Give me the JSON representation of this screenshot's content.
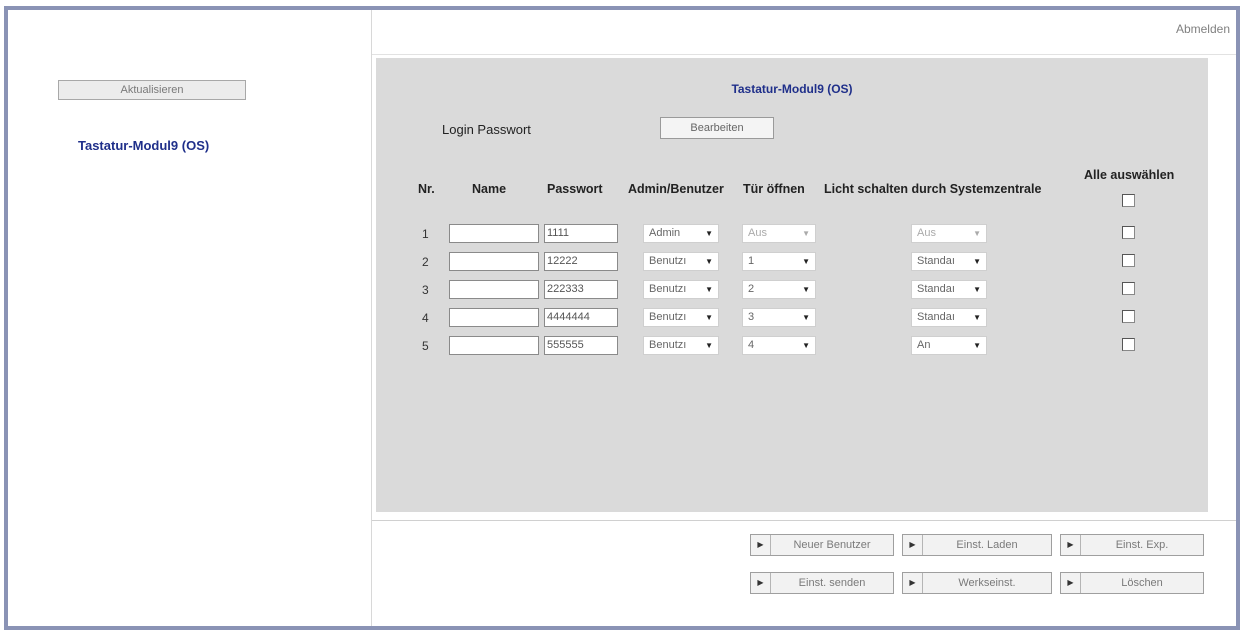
{
  "header": {
    "logout_label": "Abmelden"
  },
  "sidebar": {
    "refresh_label": "Aktualisieren",
    "module_link": "Tastatur-Modul9 (OS)"
  },
  "panel": {
    "title": "Tastatur-Modul9 (OS)",
    "login_label": "Login Passwort",
    "edit_label": "Bearbeiten",
    "columns": {
      "nr": "Nr.",
      "name": "Name",
      "password": "Passwort",
      "role": "Admin/Benutzer",
      "door": "Tür öffnen",
      "light": "Licht schalten durch Systemzentrale",
      "select_all": "Alle auswählen"
    },
    "rows": [
      {
        "nr": "1",
        "name": "",
        "password": "1111",
        "role": "Admin",
        "door": "Aus",
        "light": "Aus"
      },
      {
        "nr": "2",
        "name": "",
        "password": "12222",
        "role": "Benutzı",
        "door": "1",
        "light": "Standaı"
      },
      {
        "nr": "3",
        "name": "",
        "password": "222333",
        "role": "Benutzı",
        "door": "2",
        "light": "Standaı"
      },
      {
        "nr": "4",
        "name": "",
        "password": "4444444",
        "role": "Benutzı",
        "door": "3",
        "light": "Standaı"
      },
      {
        "nr": "5",
        "name": "",
        "password": "555555",
        "role": "Benutzı",
        "door": "4",
        "light": "An"
      }
    ]
  },
  "actions": {
    "new_user": "Neuer Benutzer",
    "load_settings": "Einst. Laden",
    "export_settings": "Einst. Exp.",
    "send_settings": "Einst. senden",
    "factory_settings": "Werkseinst.",
    "delete": "Löschen"
  },
  "colors": {
    "panel_bg": "#dadada",
    "link_blue": "#1f2f8a",
    "frame_border": "#8a93b5"
  },
  "icons": {
    "dropdown": "chevron-down-icon",
    "action_arrow": "triangle-right-icon"
  }
}
